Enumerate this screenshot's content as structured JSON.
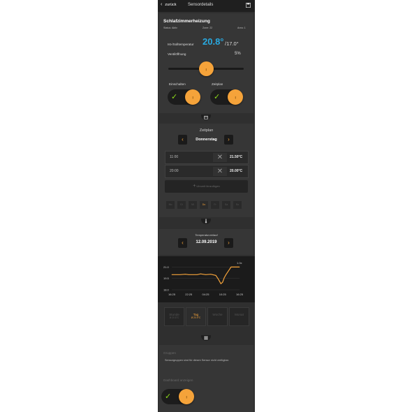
{
  "header": {
    "back_label": "zurück",
    "title": "Sensordetails"
  },
  "sensor": {
    "name": "Schlafzimmerheizung",
    "status": "Status: Aktiv",
    "zone": "Zone: 22",
    "area": "Area: 1",
    "temp_label": "Ist-/Solltemperatur",
    "current_temp": "20.8°",
    "set_temp": "/17.0°",
    "valve_label": "Ventilöffnung",
    "valve_value": "5%",
    "valve_level": 0.5,
    "switch_label": "Einschalten",
    "schedule_label": "Zeitplan"
  },
  "schedule": {
    "title": "Zeitplan",
    "day": "Donnerstag",
    "rows": [
      {
        "time": "11:00",
        "temp": "21.50°C"
      },
      {
        "time": "20:00",
        "temp": "20.00°C"
      }
    ],
    "add_label": "Uhrzeit hinzufügen",
    "days": [
      "Mo",
      "Di",
      "Mi",
      "Do",
      "Fr",
      "Sa",
      "So"
    ],
    "active_day": 3
  },
  "history": {
    "title": "Temperaturverlauf",
    "date": "12.09.2019",
    "modes": [
      {
        "label": "Stunde",
        "sub": "Ø 20.8°C"
      },
      {
        "label": "Tag",
        "sub": "Ø 20.9°C"
      },
      {
        "label": "Woche",
        "sub": ""
      },
      {
        "label": "Monat",
        "sub": ""
      }
    ],
    "active_mode": 1
  },
  "chart_data": {
    "type": "line",
    "x": [
      "16:25",
      "22:25",
      "04:25",
      "10:25",
      "16:25"
    ],
    "ylim": [
      18.0,
      21.5
    ],
    "yticks": [
      "21.0",
      "19.5",
      "18.0"
    ],
    "zoom_label": "1.0x",
    "points": [
      [
        0,
        20.0
      ],
      [
        0.3,
        20.0
      ],
      [
        0.5,
        20.0
      ],
      [
        0.8,
        20.05
      ],
      [
        1.0,
        20.0
      ],
      [
        1.5,
        20.0
      ],
      [
        1.7,
        20.1
      ],
      [
        2.0,
        20.0
      ],
      [
        2.3,
        20.05
      ],
      [
        2.6,
        19.9
      ],
      [
        2.75,
        19.4
      ],
      [
        2.9,
        18.8
      ],
      [
        3.0,
        19.0
      ],
      [
        3.1,
        19.6
      ],
      [
        3.2,
        20.0
      ],
      [
        3.35,
        20.5
      ],
      [
        3.5,
        21.0
      ],
      [
        3.7,
        21.0
      ],
      [
        4.0,
        21.0
      ]
    ],
    "color": "#f5a33a"
  },
  "groups": {
    "title": "Gruppen",
    "text": "Sensorgruppen sind für diesen Sensor nicht verfügbar.",
    "dashboard_label": "Dashboard anzeigen"
  },
  "colors": {
    "accent": "#f5a33a",
    "temp_blue": "#29a9e0",
    "check_green": "#8edc1a"
  }
}
